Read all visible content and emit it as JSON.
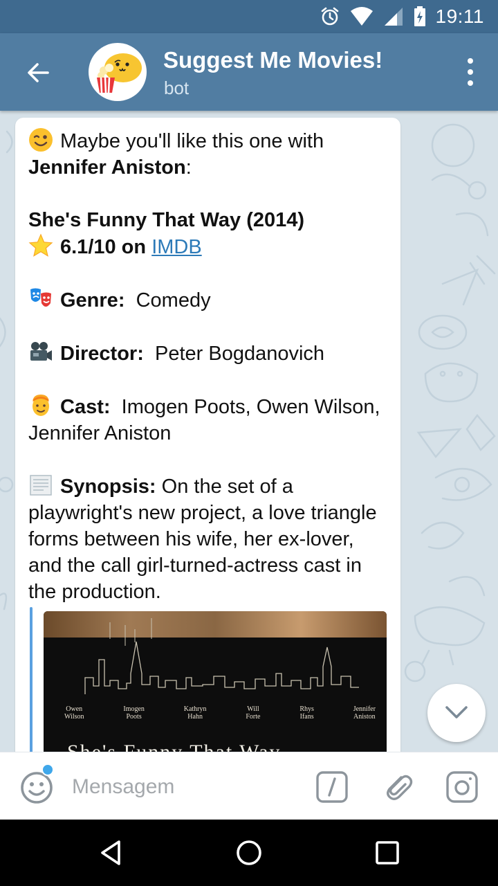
{
  "status_bar": {
    "time": "19:11"
  },
  "header": {
    "title": "Suggest Me Movies!",
    "subtitle": "bot"
  },
  "message": {
    "intro": "Maybe you'll like this one with",
    "actor": "Jennifer Aniston",
    "actor_suffix": ":",
    "movie_title": "She's Funny That Way  (2014)",
    "rating": "6.1/10 on",
    "rating_link": "IMDB",
    "genre_label": "Genre:",
    "genre_value": "Comedy",
    "director_label": "Director:",
    "director_value": "Peter Bogdanovich",
    "cast_label": "Cast:",
    "cast_value": "Imogen Poots,  Owen Wilson,  Jennifer Aniston",
    "synopsis_label": "Synopsis:",
    "synopsis_value": "On the set of a playwright's new project, a love triangle forms between his wife, her ex-lover, and the call girl-turned-actress cast in the production."
  },
  "input": {
    "placeholder": "Mensagem"
  },
  "colors": {
    "header": "#517da2",
    "status_bar": "#3f6a8f",
    "link": "#2c7ab8",
    "accent": "#3fa7ea"
  },
  "icons": {
    "back": "arrow-left-icon",
    "more": "more-vert-icon",
    "scroll": "chevron-down-icon",
    "emoji": "smiley-icon",
    "command": "slash-command-icon",
    "attach": "paperclip-icon",
    "camera": "camera-icon"
  }
}
